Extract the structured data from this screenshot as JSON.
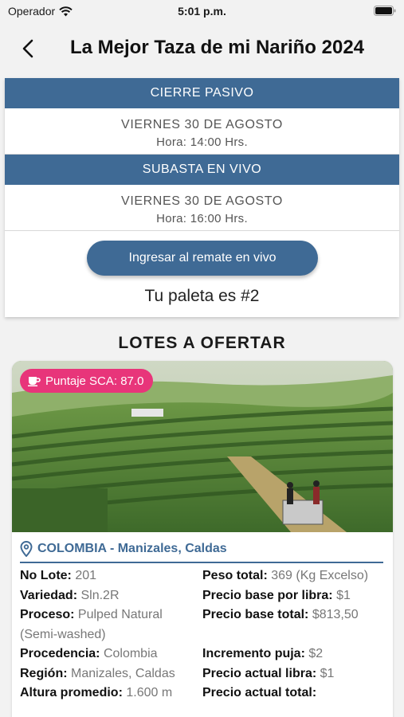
{
  "status_bar": {
    "carrier": "Operador",
    "time": "5:01 p.m."
  },
  "nav": {
    "title": "La Mejor Taza de mi Nariño 2024"
  },
  "schedule": {
    "passive": {
      "label": "CIERRE PASIVO",
      "date": "VIERNES 30 DE AGOSTO",
      "hour": "Hora: 14:00 Hrs."
    },
    "live": {
      "label": "SUBASTA EN VIVO",
      "date": "VIERNES 30 DE AGOSTO",
      "hour": "Hora: 16:00 Hrs."
    },
    "live_button": "Ingresar al remate en vivo",
    "paddle": "Tu paleta es #2"
  },
  "lots": {
    "title": "LOTES A OFERTAR",
    "items": [
      {
        "badge": "Puntaje SCA: 87.0",
        "location": "COLOMBIA - Manizales, Caldas",
        "rows": [
          {
            "lk": "No Lote:",
            "lv": "201",
            "rk": "Peso total:",
            "rv": "369 (Kg Excelso)"
          },
          {
            "lk": "Variedad:",
            "lv": "Sln.2R",
            "rk": "Precio base por libra:",
            "rv": "$1"
          },
          {
            "lk": "Proceso:",
            "lv": "Pulped Natural (Semi-washed)",
            "rk": "Precio base total:",
            "rv": "$813,50"
          },
          {
            "lk": "Procedencia:",
            "lv": "Colombia",
            "rk": "Incremento puja:",
            "rv": "$2"
          },
          {
            "lk": "Región:",
            "lv": "Manizales, Caldas",
            "rk": "Precio actual libra:",
            "rv": "$1"
          },
          {
            "lk": "Altura promedio:",
            "lv": "1.600 m",
            "rk": "Precio actual total:",
            "rv": ""
          }
        ]
      }
    ]
  },
  "colors": {
    "primary": "#3f6a95",
    "badge": "#e8357a"
  }
}
